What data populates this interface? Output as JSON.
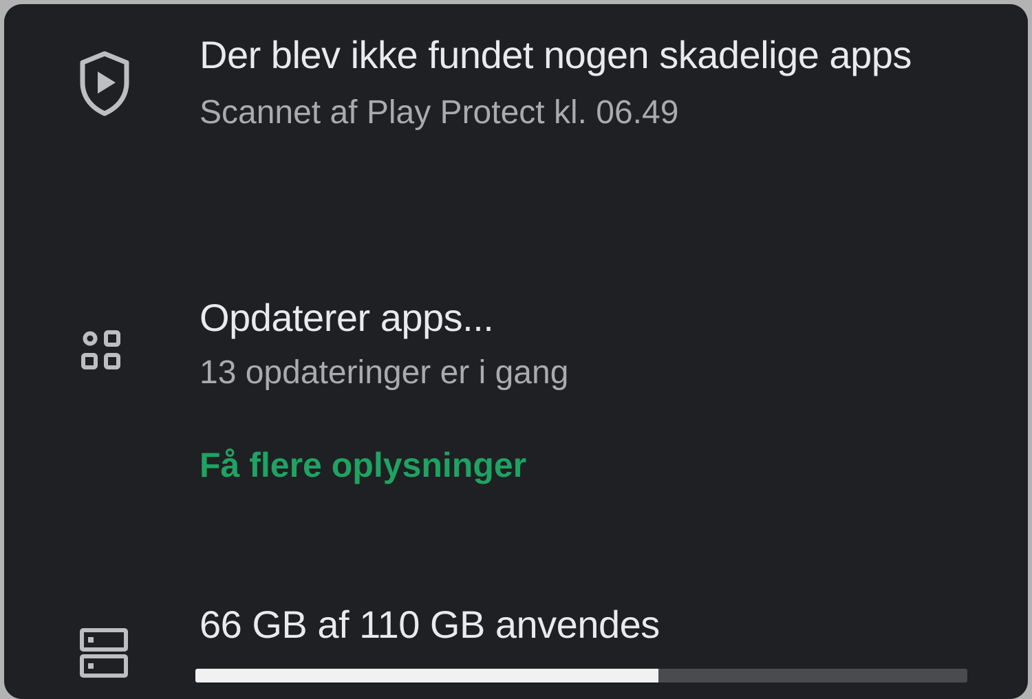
{
  "play_protect": {
    "icon": "shield-play-icon",
    "title": "Der blev ikke fundet nogen skadelige apps",
    "subtitle": "Scannet af Play Protect kl. 06.49"
  },
  "updates": {
    "icon": "apps-grid-icon",
    "title": "Opdaterer apps...",
    "subtitle": "13 opdateringer er i gang",
    "link_label": "Få flere oplysninger",
    "link_color": "#1ea362"
  },
  "storage": {
    "icon": "storage-icon",
    "title": "66 GB af 110 GB anvendes",
    "used_fraction": 0.6
  },
  "colors": {
    "background": "#1f2023",
    "title_text": "#e8eaed",
    "subtitle_text": "#a9abae",
    "accent_link": "#1ea362",
    "progress_fill": "#f1f1f1",
    "progress_track": "#4a4b4e"
  }
}
